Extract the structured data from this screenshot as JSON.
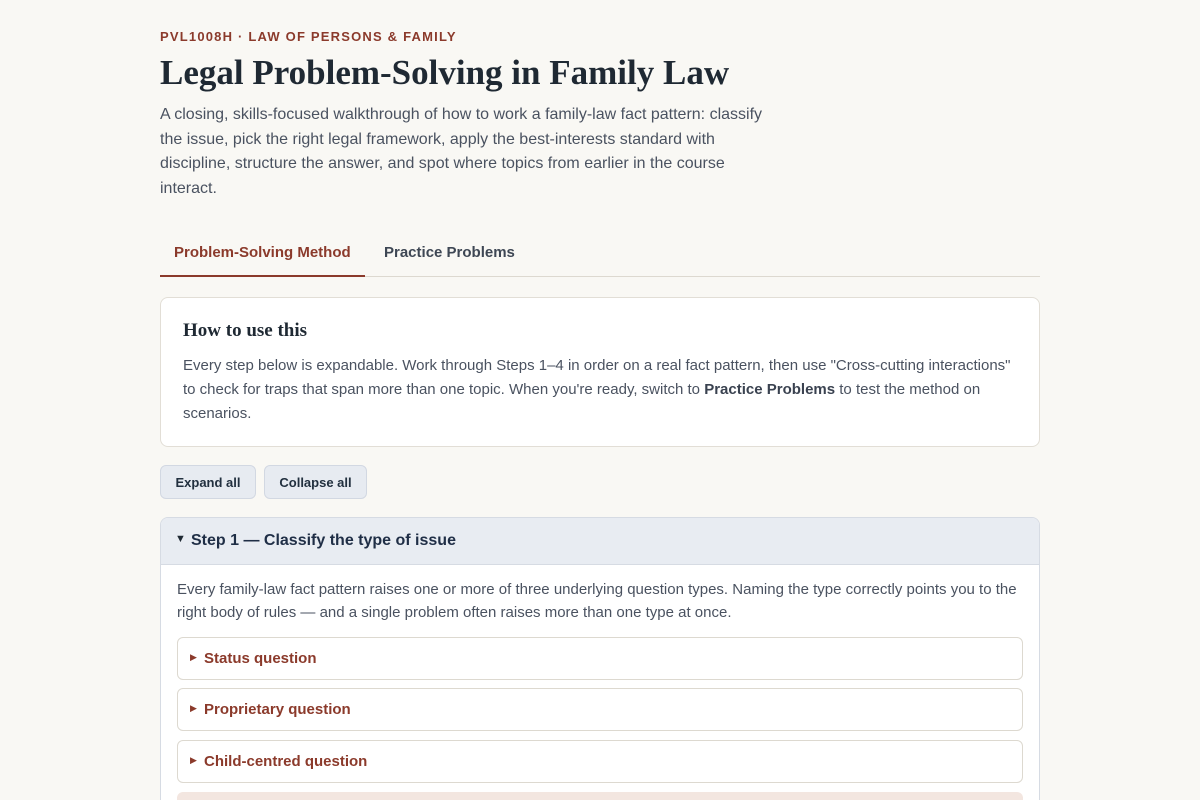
{
  "header": {
    "eyebrow": "PVL1008H · LAW OF PERSONS & FAMILY",
    "title": "Legal Problem-Solving in Family Law",
    "intro": "A closing, skills-focused walkthrough of how to work a family-law fact pattern: classify the issue, pick the right legal framework, apply the best-interests standard with discipline, structure the answer, and spot where topics from earlier in the course interact."
  },
  "tabs": [
    {
      "label": "Problem-Solving Method",
      "active": true
    },
    {
      "label": "Practice Problems",
      "active": false
    }
  ],
  "howto": {
    "title": "How to use this",
    "body_part1": "Every step below is expandable. Work through Steps 1–4 in order on a real fact pattern, then use \"Cross-cutting interactions\" to check for traps that span more than one topic. When you're ready, switch to ",
    "body_strong": "Practice Problems",
    "body_part2": " to test the method on scenarios."
  },
  "controls": {
    "expand_all": "Expand all",
    "collapse_all": "Collapse all"
  },
  "step1": {
    "caret": "▼",
    "title": "Step 1 — Classify the type of issue",
    "description": "Every family-law fact pattern raises one or more of three underlying question types. Naming the type correctly points you to the right body of rules — and a single problem often raises more than one type at once.",
    "items": [
      {
        "label": "Status question"
      },
      {
        "label": "Proprietary question"
      },
      {
        "label": "Child-centred question"
      }
    ]
  },
  "colors": {
    "accent": "#8b3a2b",
    "background": "#f9f8f4",
    "step_header": "#e8ecf2"
  },
  "icons": {
    "expanded": "caret-down-icon",
    "collapsed": "caret-right-icon"
  }
}
